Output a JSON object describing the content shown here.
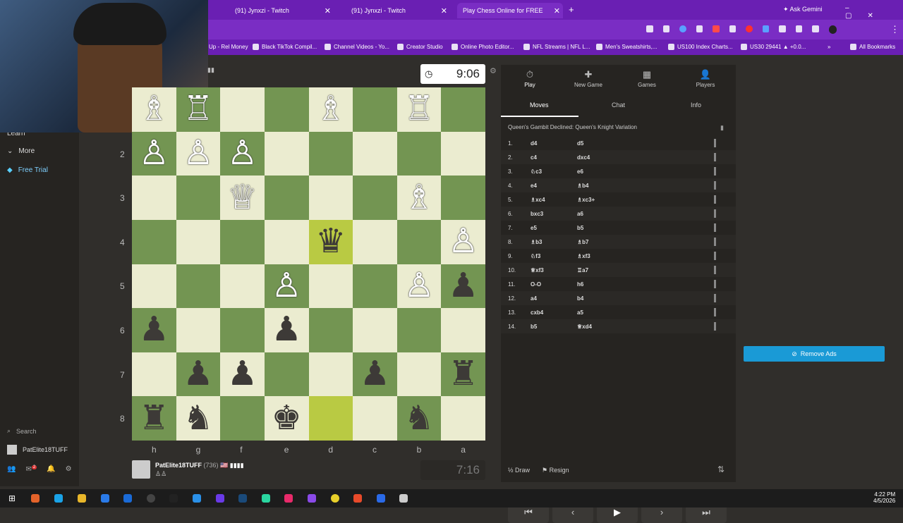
{
  "browser": {
    "tabs": [
      {
        "label": "(91) Jynxzi - Twitch"
      },
      {
        "label": "(91) Jynxzi - Twitch"
      },
      {
        "label": "Play Chess Online for FREE"
      }
    ],
    "ask_gemini": "Ask Gemini",
    "bookmarks": [
      "Up - Rel Money",
      "Black TikTok Compil...",
      "Channel Videos - Yo...",
      "Creator Studio",
      "Online Photo Editor...",
      "NFL Streams | NFL L...",
      "Men's Sweatshirts,...",
      "US100 Index Charts...",
      "US30 29441 ▲ +0.0..."
    ],
    "all_bookmarks": "All Bookmarks"
  },
  "sidebar": {
    "learn": "Learn",
    "more": "More",
    "free_trial": "Free Trial",
    "search": "Search",
    "username": "PatElite18TUFF",
    "notif_count": "2"
  },
  "clocks": {
    "top": "9:06",
    "bottom": "7:16"
  },
  "player": {
    "name": "PatElite18TUFF",
    "rating": "(736)"
  },
  "board": {
    "ranks": [
      "1",
      "2",
      "3",
      "4",
      "5",
      "6",
      "7",
      "8"
    ],
    "files": [
      "h",
      "g",
      "f",
      "e",
      "d",
      "c",
      "b",
      "a"
    ],
    "squares": [
      [
        "♗",
        "♖",
        "",
        "",
        "♗",
        "",
        "♖"
      ],
      [
        "♙",
        "♙",
        "♙",
        "",
        "",
        "",
        "",
        ""
      ],
      [
        "",
        "",
        "♕",
        "",
        "",
        "",
        "♗",
        ""
      ],
      [
        "",
        "",
        "",
        "",
        "♛",
        "",
        "",
        "♙"
      ],
      [
        "",
        "",
        "",
        "♙",
        "",
        "",
        "♙",
        "♟"
      ],
      [
        "♟",
        "",
        "",
        "♟",
        "",
        "",
        "",
        ""
      ],
      [
        "",
        "♟",
        "♟",
        "",
        "",
        "♟",
        "",
        "♜"
      ],
      [
        "♜",
        "♞",
        "",
        "♚",
        "",
        "",
        "♞",
        ""
      ]
    ]
  },
  "panel": {
    "nav": [
      {
        "label": "Play",
        "icon": "⏱"
      },
      {
        "label": "New Game",
        "icon": "✚"
      },
      {
        "label": "Games",
        "icon": "▦"
      },
      {
        "label": "Players",
        "icon": "👤"
      }
    ],
    "subtabs": [
      "Moves",
      "Chat",
      "Info"
    ],
    "opening": "Queen's Gambit Declined: Queen's Knight Variation",
    "moves": [
      {
        "n": "1.",
        "w": "d4",
        "b": "d5"
      },
      {
        "n": "2.",
        "w": "c4",
        "b": "dxc4"
      },
      {
        "n": "3.",
        "w": "♘c3",
        "b": "e6"
      },
      {
        "n": "4.",
        "w": "e4",
        "b": "♗b4"
      },
      {
        "n": "5.",
        "w": "♗xc4",
        "b": "♗xc3+"
      },
      {
        "n": "6.",
        "w": "bxc3",
        "b": "a6"
      },
      {
        "n": "7.",
        "w": "e5",
        "b": "b5"
      },
      {
        "n": "8.",
        "w": "♗b3",
        "b": "♗b7"
      },
      {
        "n": "9.",
        "w": "♘f3",
        "b": "♗xf3"
      },
      {
        "n": "10.",
        "w": "♕xf3",
        "b": "♖a7"
      },
      {
        "n": "11.",
        "w": "O-O",
        "b": "h6"
      },
      {
        "n": "12.",
        "w": "a4",
        "b": "b4"
      },
      {
        "n": "13.",
        "w": "cxb4",
        "b": "a5"
      },
      {
        "n": "14.",
        "w": "b5",
        "b": "♕xd4"
      }
    ],
    "draw": "Draw",
    "resign": "Resign"
  },
  "ads": {
    "remove": "Remove Ads"
  },
  "system": {
    "time": "4:22 PM",
    "date": "4/5/2026"
  },
  "colors": {
    "light_square": "#ebecd0",
    "dark_square": "#739552",
    "highlight": "#b9ca43",
    "accent": "#1a9ad6"
  }
}
